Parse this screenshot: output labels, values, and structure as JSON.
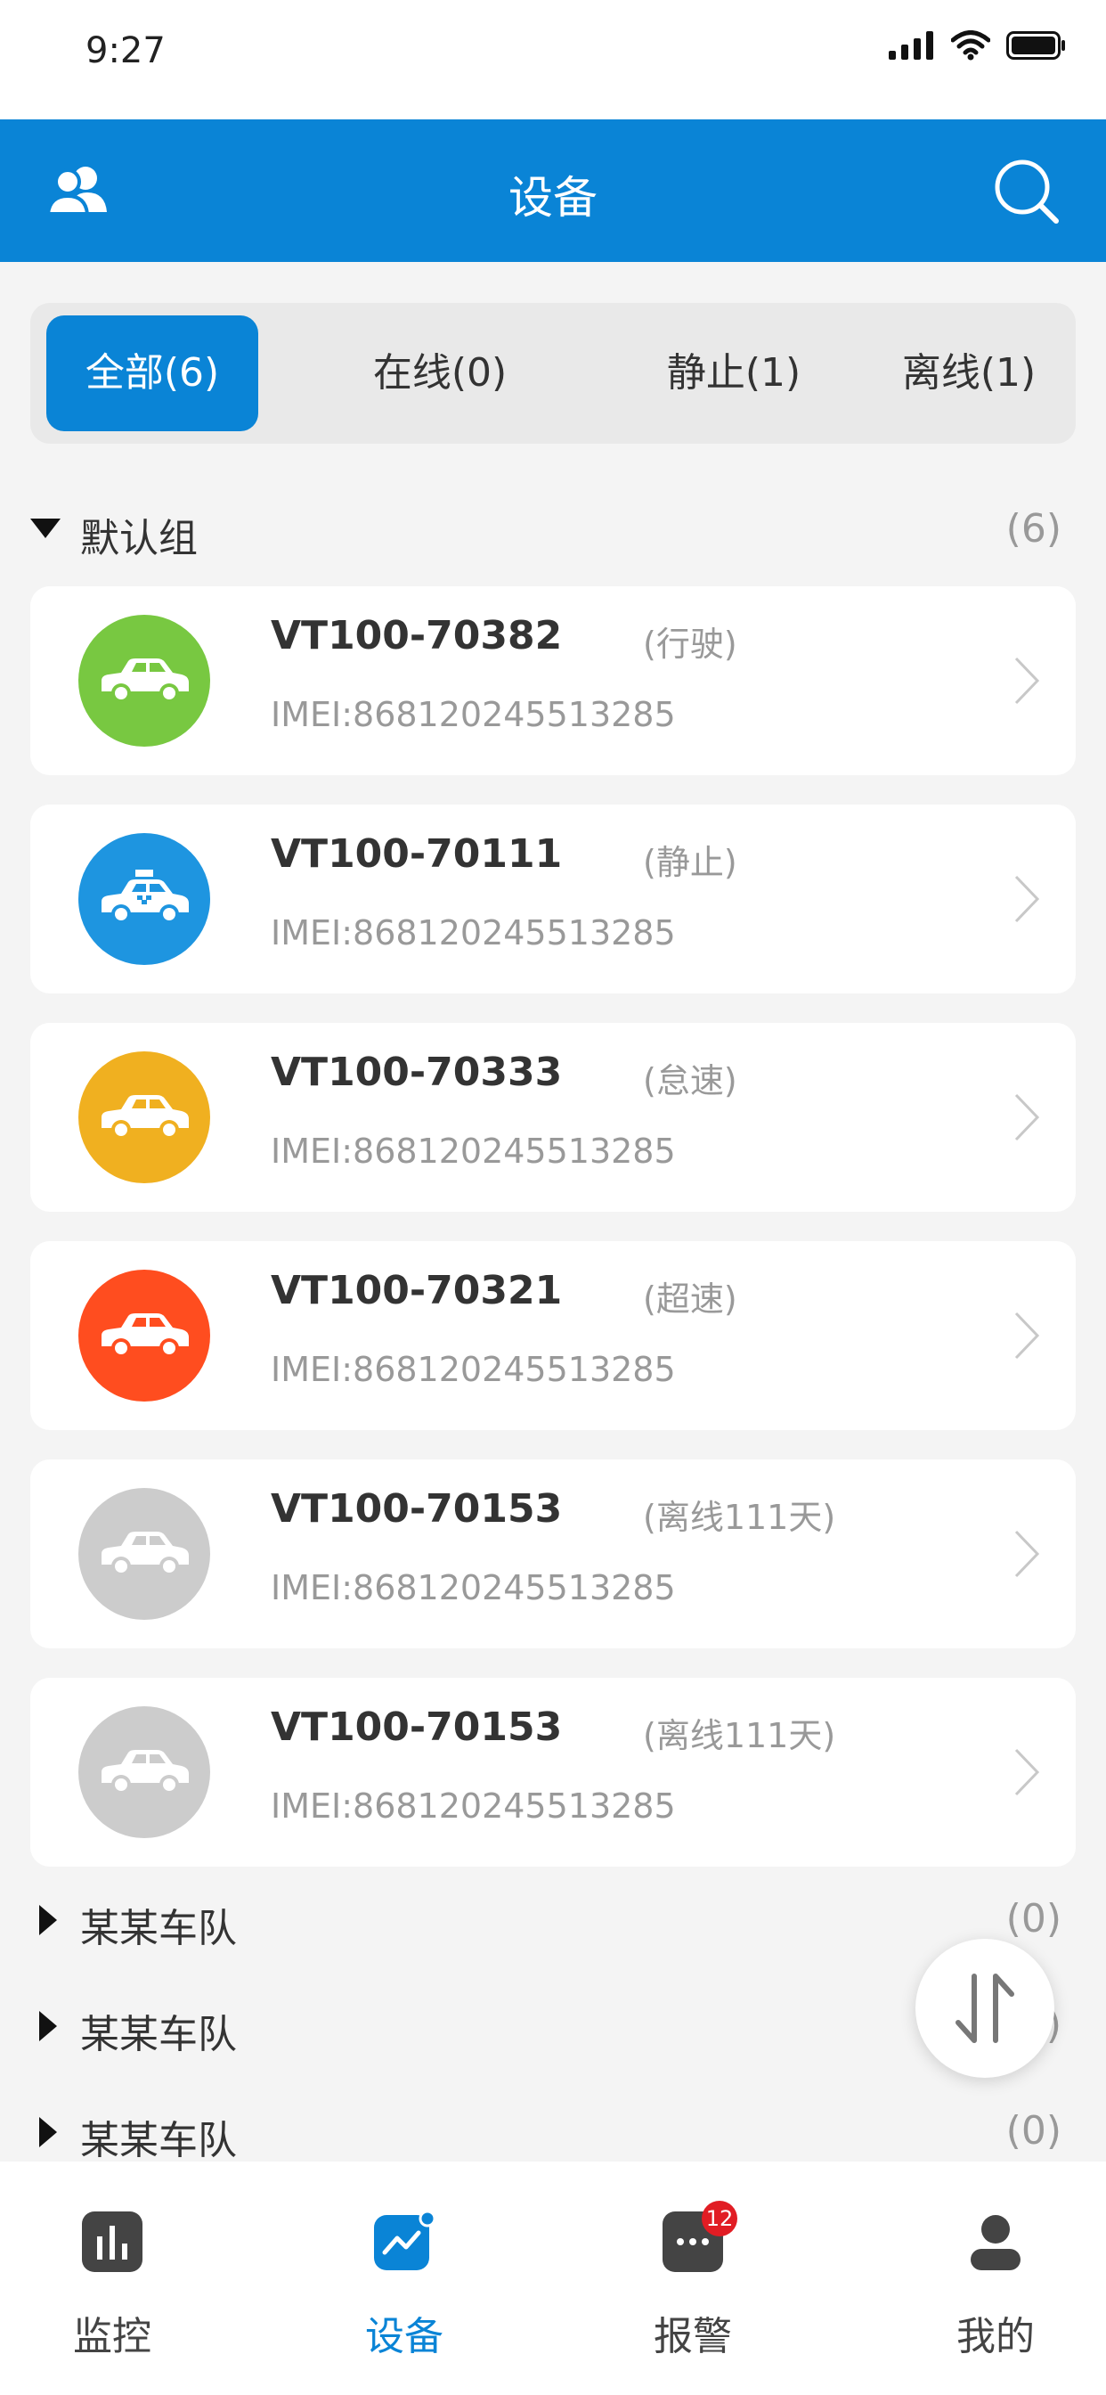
{
  "status_bar": {
    "time": "9:27"
  },
  "header": {
    "title": "设备"
  },
  "tabs": [
    {
      "label": "全部(6)",
      "active": true
    },
    {
      "label": "在线(0)",
      "active": false
    },
    {
      "label": "静止(1)",
      "active": false
    },
    {
      "label": "离线(1)",
      "active": false
    }
  ],
  "groups": [
    {
      "name": "默认组",
      "count": "(6)",
      "expanded": true
    },
    {
      "name": "某某车队",
      "count": "(0)",
      "expanded": false
    },
    {
      "name": "某某车队",
      "count": "(0)",
      "expanded": false
    },
    {
      "name": "某某车队",
      "count": "(0)",
      "expanded": false
    }
  ],
  "devices": [
    {
      "name": "VT100-70382",
      "status": "(行驶)",
      "imei": "IMEI:868120245513285",
      "color": "#78c841",
      "icon": "car-icon"
    },
    {
      "name": "VT100-70111",
      "status": "(静止)",
      "imei": "IMEI:868120245513285",
      "color": "#1e95e0",
      "icon": "taxi-icon"
    },
    {
      "name": "VT100-70333",
      "status": "(怠速)",
      "imei": "IMEI:868120245513285",
      "color": "#f0b020",
      "icon": "car-icon"
    },
    {
      "name": "VT100-70321",
      "status": "(超速)",
      "imei": "IMEI:868120245513285",
      "color": "#ff4d1f",
      "icon": "car-icon"
    },
    {
      "name": "VT100-70153",
      "status": "(离线111天)",
      "imei": "IMEI:868120245513285",
      "color": "#cccccc",
      "icon": "car-icon"
    },
    {
      "name": "VT100-70153",
      "status": "(离线111天)",
      "imei": "IMEI:868120245513285",
      "color": "#cccccc",
      "icon": "car-icon"
    }
  ],
  "tabbar": [
    {
      "label": "监控",
      "icon": "chart-icon",
      "active": false
    },
    {
      "label": "设备",
      "icon": "device-icon",
      "active": true
    },
    {
      "label": "报警",
      "icon": "message-icon",
      "active": false,
      "badge": "12"
    },
    {
      "label": "我的",
      "icon": "user-icon",
      "active": false
    }
  ],
  "colors": {
    "primary": "#0a84d6",
    "badge": "#e11d24"
  }
}
